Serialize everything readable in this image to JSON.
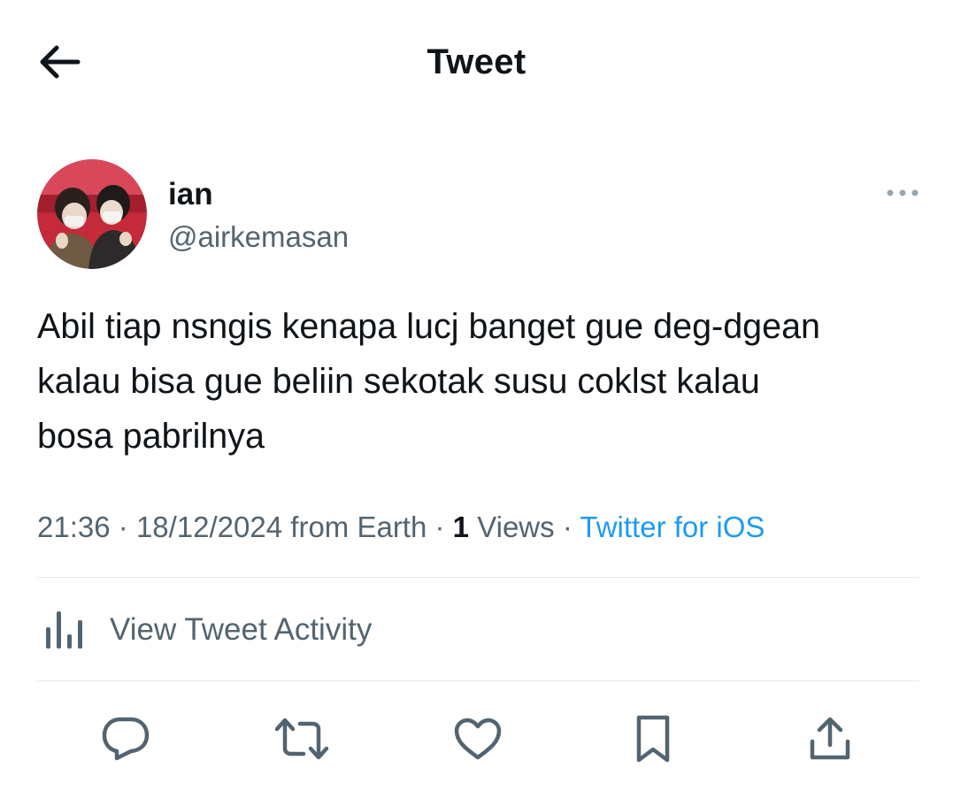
{
  "header": {
    "title": "Tweet",
    "back_icon": "arrow-left-icon"
  },
  "author": {
    "name": "ian",
    "handle": "@airkemasan",
    "avatar_icon": "avatar-photo",
    "more_icon": "more-horizontal-icon"
  },
  "tweet": {
    "text": "Abil tiap nsngis kenapa lucj banget gue deg-dgean\nkalau bisa gue beliin sekotak susu coklst kalau\nbosa pabrilnya"
  },
  "meta": {
    "time": "21:36",
    "date": "18/12/2024",
    "location_text": "from Earth",
    "separator": "·",
    "views_count": "1",
    "views_label": "Views",
    "source": "Twitter for iOS"
  },
  "activity": {
    "label": "View Tweet Activity",
    "icon": "bar-chart-icon"
  },
  "actions": {
    "reply_icon": "reply-icon",
    "retweet_icon": "retweet-icon",
    "like_icon": "heart-icon",
    "bookmark_icon": "bookmark-icon",
    "share_icon": "share-icon"
  },
  "colors": {
    "text_primary": "#0f1419",
    "text_secondary": "#536471",
    "link": "#1d9bf0",
    "divider": "#e6e9eb"
  }
}
